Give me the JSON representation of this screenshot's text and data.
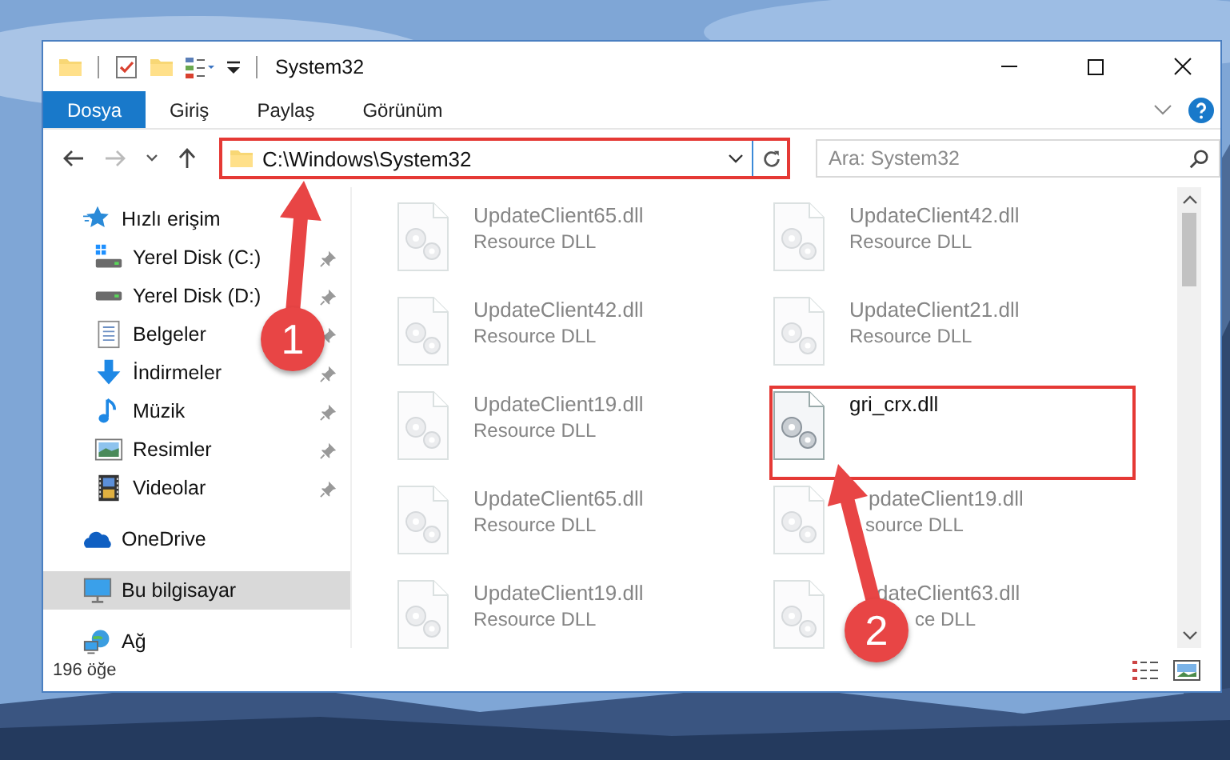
{
  "window": {
    "title": "System32"
  },
  "ribbon": {
    "tabs": [
      {
        "label": "Dosya",
        "selected": true
      },
      {
        "label": "Giriş",
        "selected": false
      },
      {
        "label": "Paylaş",
        "selected": false
      },
      {
        "label": "Görünüm",
        "selected": false
      }
    ]
  },
  "address": {
    "path": "C:\\Windows\\System32",
    "highlighted": true
  },
  "search": {
    "placeholder": "Ara: System32"
  },
  "sidebar": {
    "items": [
      {
        "label": "Hızlı erişim",
        "kind": "quick",
        "selected": false,
        "children": [
          {
            "label": "Yerel Disk (C:)",
            "kind": "system-drive",
            "pinned": true,
            "selected": false
          },
          {
            "label": "Yerel Disk (D:)",
            "kind": "drive",
            "pinned": true,
            "selected": false
          },
          {
            "label": "Belgeler",
            "kind": "documents",
            "pinned": true,
            "selected": false
          },
          {
            "label": "İndirmeler",
            "kind": "downloads",
            "pinned": true,
            "selected": false
          },
          {
            "label": "Müzik",
            "kind": "music",
            "pinned": true,
            "selected": false
          },
          {
            "label": "Resimler",
            "kind": "pictures",
            "pinned": true,
            "selected": false
          },
          {
            "label": "Videolar",
            "kind": "videos",
            "pinned": true,
            "selected": false
          }
        ]
      },
      {
        "label": "OneDrive",
        "kind": "cloud",
        "selected": false
      },
      {
        "label": "Bu bilgisayar",
        "kind": "computer",
        "selected": true
      },
      {
        "label": "Ağ",
        "kind": "network",
        "selected": false
      }
    ]
  },
  "files": [
    {
      "name": "UpdateClient65.dll",
      "type": "Resource DLL",
      "blurred": true,
      "highlighted": false
    },
    {
      "name": "UpdateClient42.dll",
      "type": "Resource DLL",
      "blurred": true,
      "highlighted": false
    },
    {
      "name": "UpdateClient42.dll",
      "type": "Resource DLL",
      "blurred": true,
      "highlighted": false
    },
    {
      "name": "UpdateClient21.dll",
      "type": "Resource DLL",
      "blurred": true,
      "highlighted": false
    },
    {
      "name": "UpdateClient19.dll",
      "type": "Resource DLL",
      "blurred": true,
      "highlighted": false
    },
    {
      "name": "gri_crx.dll",
      "blurred": false,
      "highlighted": true
    },
    {
      "name": "UpdateClient65.dll",
      "type": "Resource DLL",
      "blurred": true,
      "highlighted": false
    },
    {
      "name": "pdateClient19.dll",
      "type": "source DLL",
      "blurred": true,
      "highlighted": false
    },
    {
      "name": "UpdateClient19.dll",
      "type": "Resource DLL",
      "blurred": true,
      "highlighted": false
    },
    {
      "name": "dateClient63.dll",
      "type": "ce DLL",
      "blurred": true,
      "highlighted": false
    }
  ],
  "status_bar": {
    "count": "196 öğe"
  },
  "callouts": [
    {
      "number": "1"
    },
    {
      "number": "2"
    }
  ]
}
